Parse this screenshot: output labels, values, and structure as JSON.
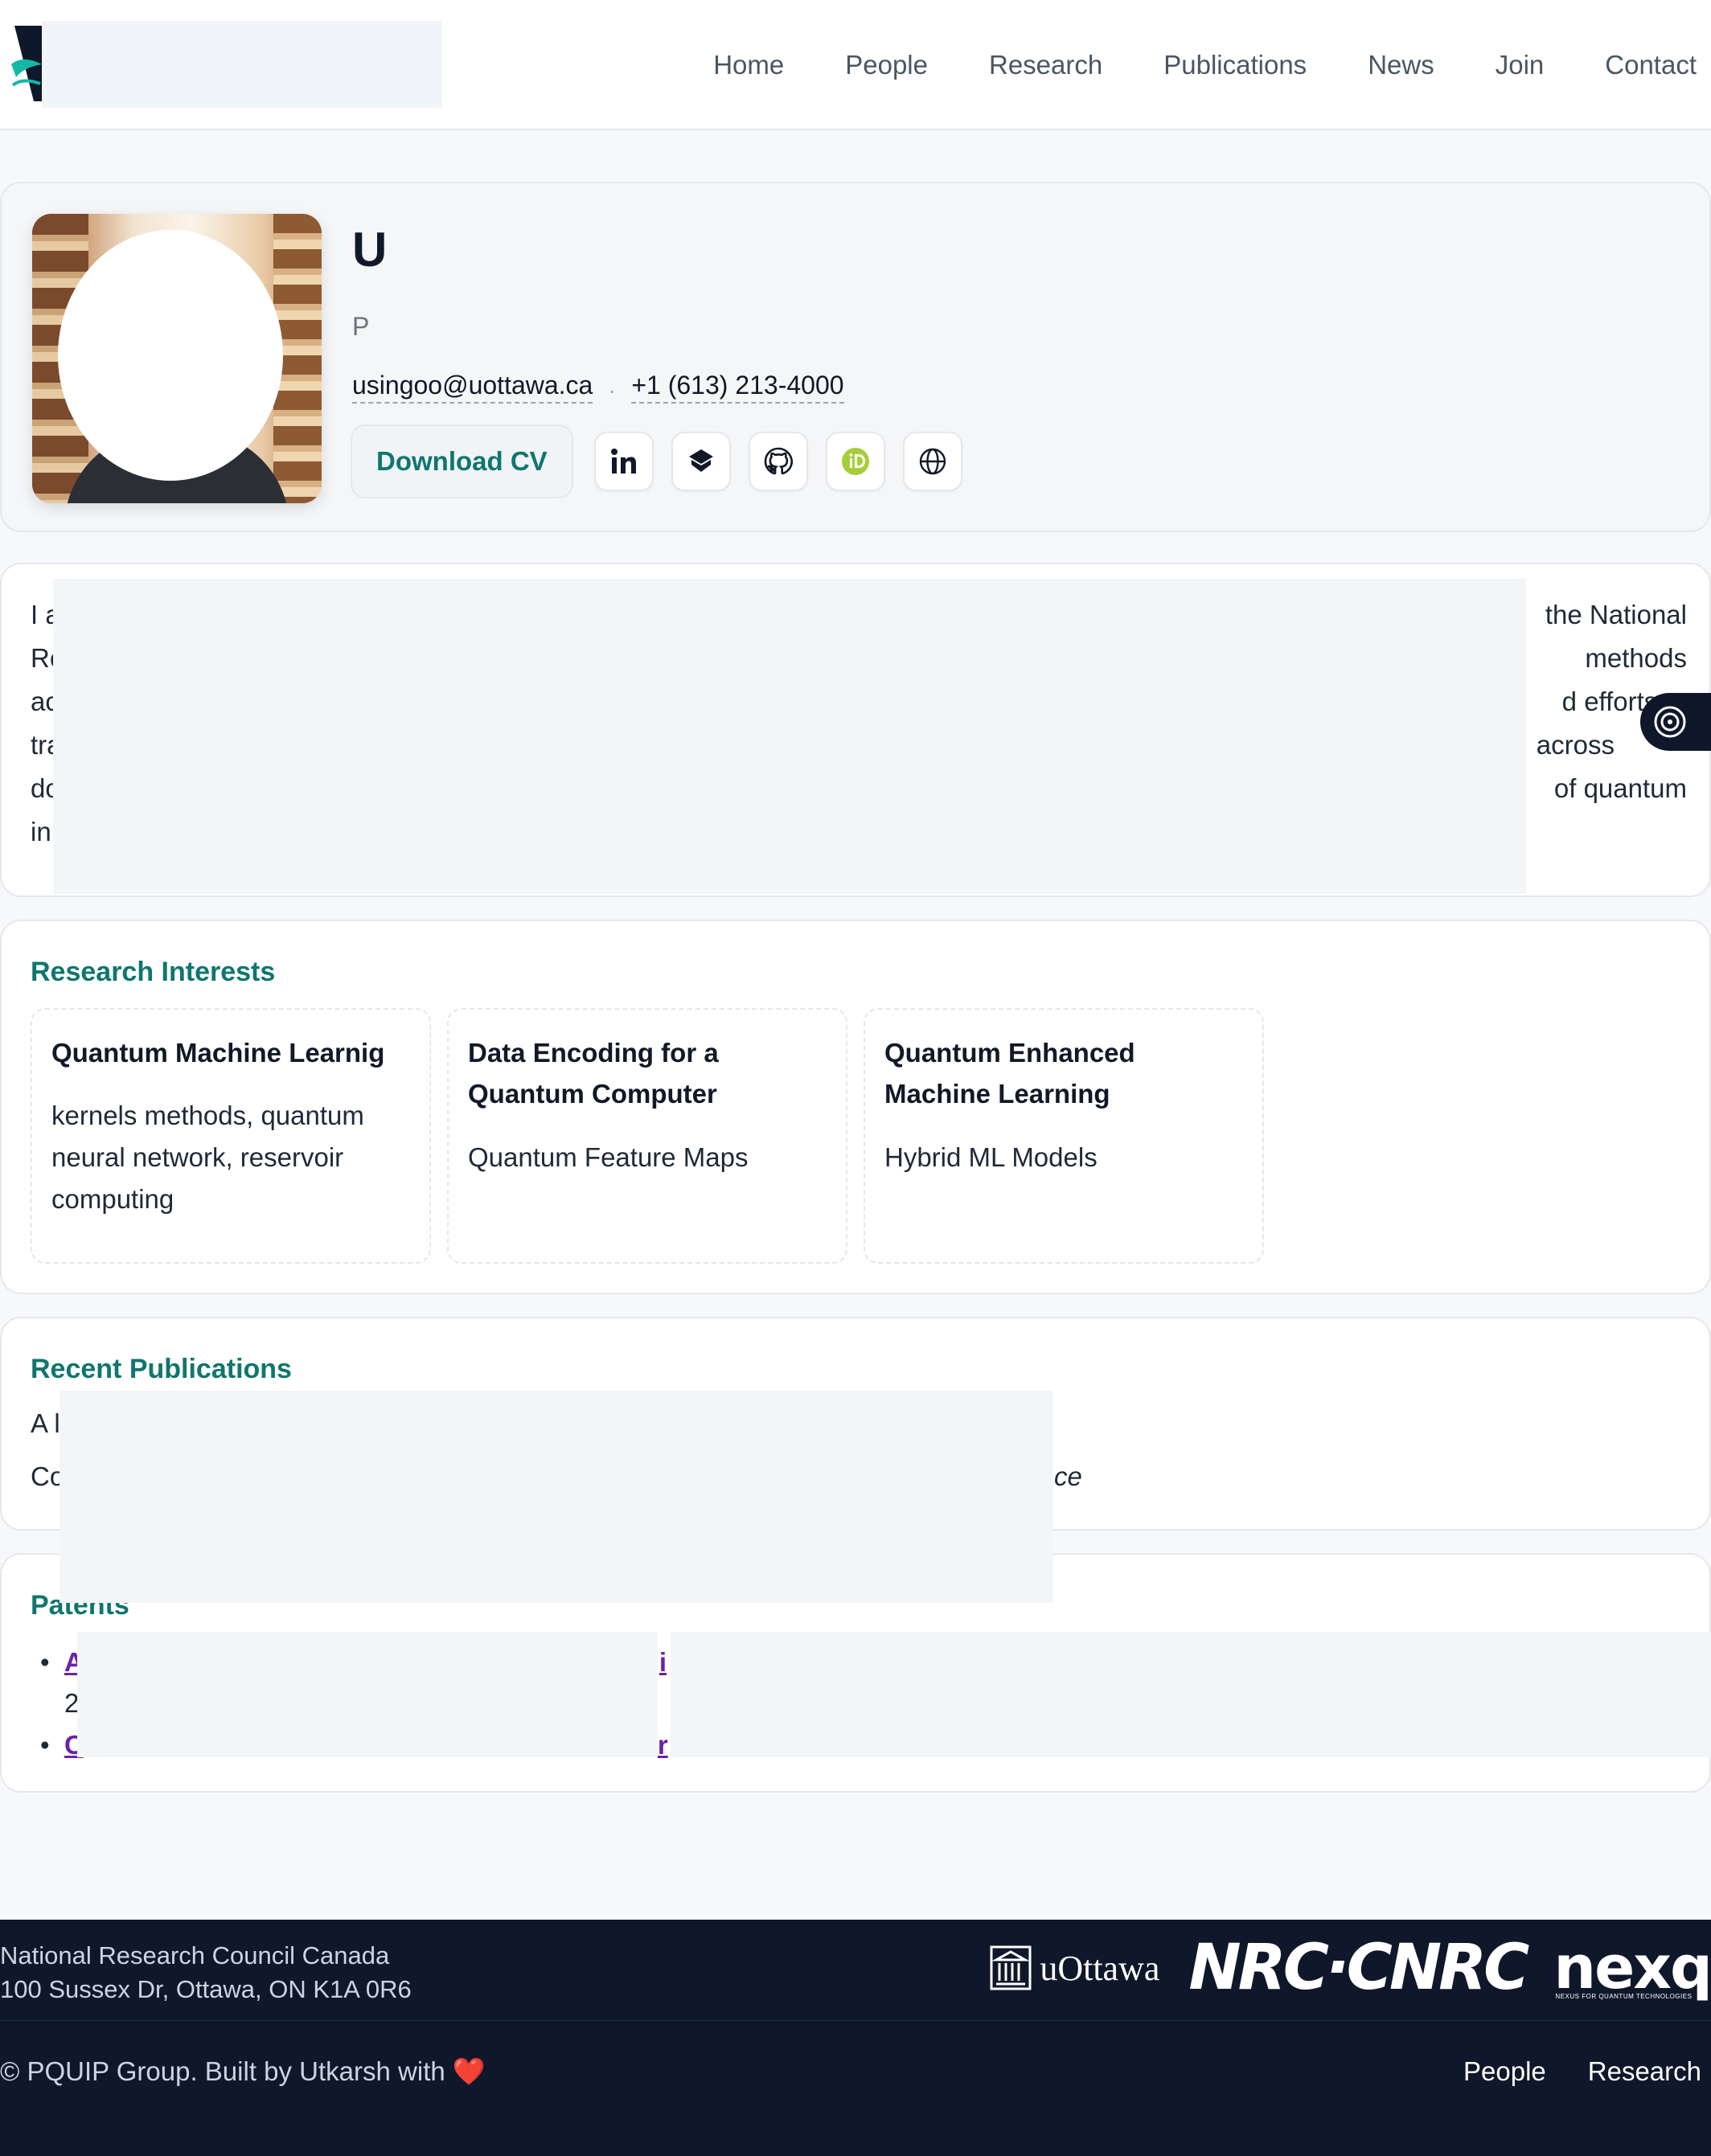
{
  "nav": {
    "links": [
      "Home",
      "People",
      "Research",
      "Publications",
      "News",
      "Join",
      "Contact"
    ]
  },
  "profile": {
    "name": "U",
    "role": "P",
    "email": "usingoo@uottawa.ca",
    "phone": "+1 (613) 213-4000",
    "download_cv": "Download CV",
    "social_icons": [
      "linkedin-icon",
      "scholar-icon",
      "github-icon",
      "orcid-icon",
      "website-icon"
    ]
  },
  "about": {
    "lines": [
      {
        "start": "I a",
        "end": "the National"
      },
      {
        "start": "Re",
        "end": "methods"
      },
      {
        "start": "ac",
        "end": "d efforts to"
      },
      {
        "start": "tra",
        "end": "across"
      },
      {
        "start": "do",
        "end": "of quantum"
      },
      {
        "start": "in",
        "end": ""
      }
    ]
  },
  "interests": {
    "title": "Research Interests",
    "items": [
      {
        "title": "Quantum Machine Learnig",
        "desc": "kernels methods, quantum neural network, reservoir computing"
      },
      {
        "title": "Data Encoding for a Quantum Computer",
        "desc": "Quantum Feature Maps"
      },
      {
        "title": "Quantum Enhanced Machine Learning",
        "desc": "Hybrid ML Models"
      }
    ]
  },
  "publications": {
    "title": "Recent Publications",
    "line1": "A l",
    "line2": "Co",
    "venue": "gence"
  },
  "patents": {
    "title": "Patents",
    "items": [
      {
        "link_start": "A",
        "link_end": "i",
        "date": "2"
      },
      {
        "link_start": "C",
        "link_end": "r",
        "date": ""
      }
    ]
  },
  "footer": {
    "org": "National Research Council Canada",
    "address": "100 Sussex Dr, Ottawa, ON K1A 0R6",
    "logos": {
      "uottawa": "uOttawa",
      "nrc": "NRC·CNRC",
      "next": "nexq",
      "next_tagline": "NEXUS FOR QUANTUM TECHNOLOGIES"
    },
    "copyright": "© PQUIP Group. Built by Utkarsh with",
    "heart": "❤️",
    "links": [
      "People",
      "Research"
    ]
  },
  "colors": {
    "accent": "#0f766e",
    "footer_bg": "#0f172a",
    "patent_link": "#6b21a8",
    "redaction": "#f3f6f9"
  }
}
